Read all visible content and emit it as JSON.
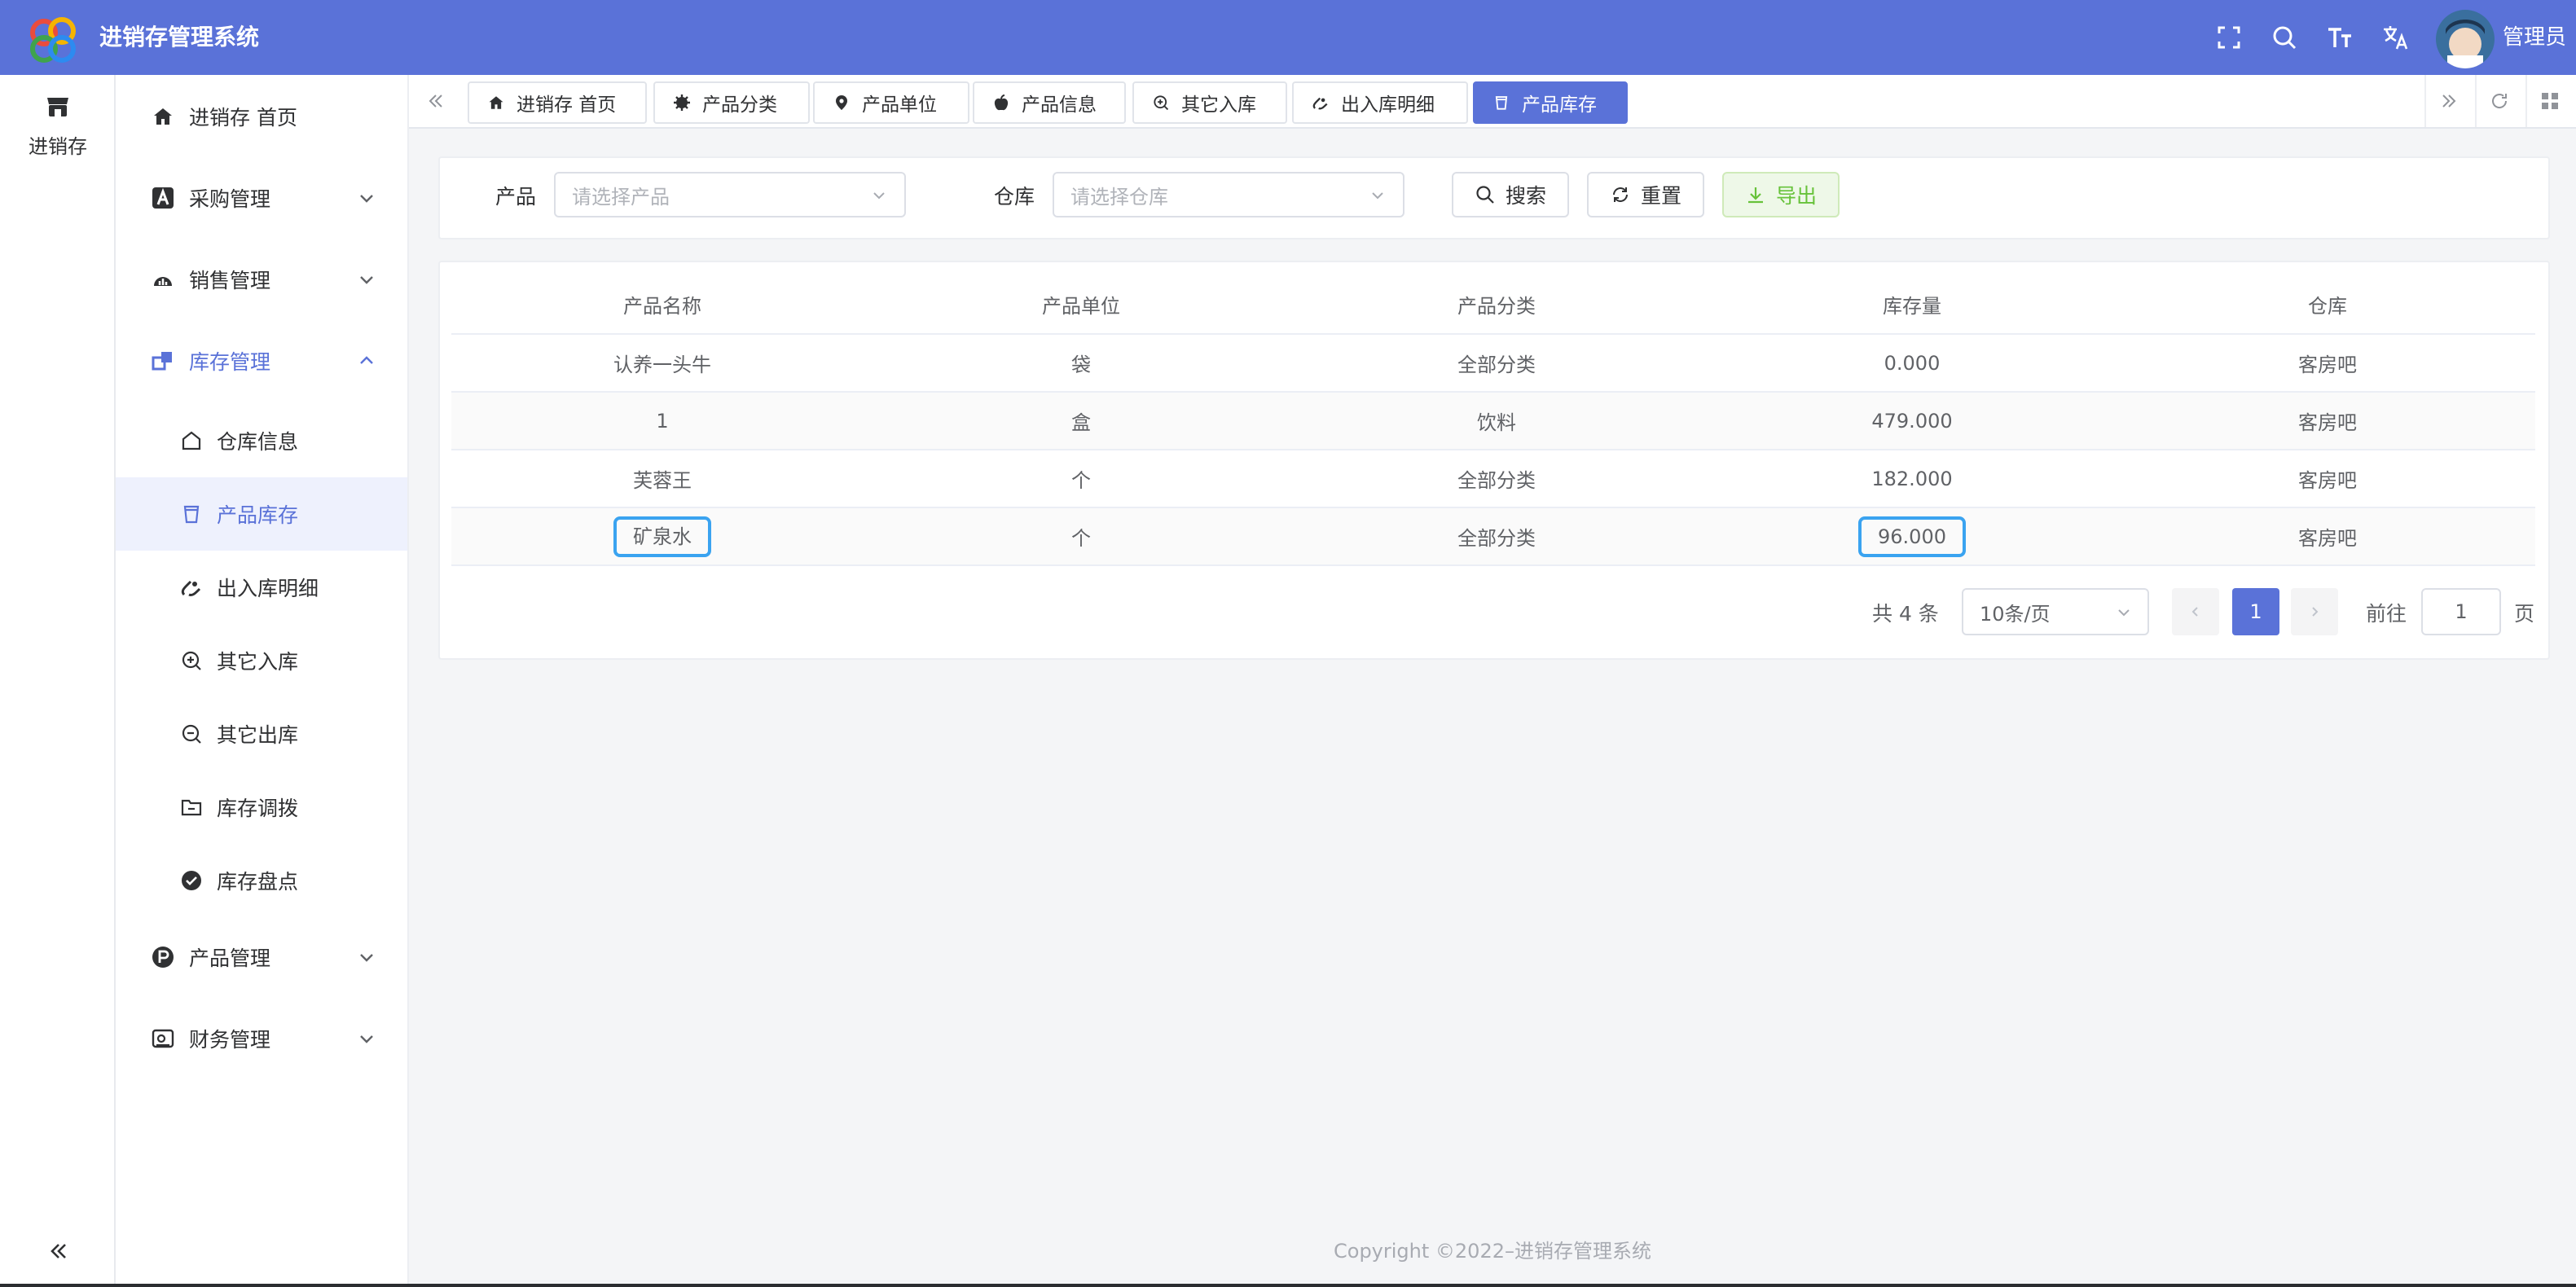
{
  "header": {
    "app_title": "进销存管理系统",
    "admin_name": "管理员",
    "icons": [
      "fullscreen-icon",
      "search-icon",
      "font-size-icon",
      "translate-icon"
    ],
    "brand_color": "#5a72d8"
  },
  "rail": {
    "label": "进销存",
    "icon": "store-icon"
  },
  "sidebar": {
    "home": "进销存 首页",
    "purchase": "采购管理",
    "sales": "销售管理",
    "inventory": "库存管理",
    "inventory_children": [
      "仓库信息",
      "产品库存",
      "出入库明细",
      "其它入库",
      "其它出库",
      "库存调拨",
      "库存盘点"
    ],
    "product": "产品管理",
    "finance": "财务管理"
  },
  "tabs": [
    "进销存 首页",
    "产品分类",
    "产品单位",
    "产品信息",
    "其它入库",
    "出入库明细",
    "产品库存"
  ],
  "filters": {
    "product_label": "产品",
    "product_placeholder": "请选择产品",
    "warehouse_label": "仓库",
    "warehouse_placeholder": "请选择仓库",
    "search_btn": "搜索",
    "reset_btn": "重置",
    "export_btn": "导出"
  },
  "table": {
    "columns": [
      "产品名称",
      "产品单位",
      "产品分类",
      "库存量",
      "仓库"
    ],
    "rows": [
      [
        "认养一头牛",
        "袋",
        "全部分类",
        "0.000",
        "客房吧"
      ],
      [
        "1",
        "盒",
        "饮料",
        "479.000",
        "客房吧"
      ],
      [
        "芙蓉王",
        "个",
        "全部分类",
        "182.000",
        "客房吧"
      ],
      [
        "矿泉水",
        "个",
        "全部分类",
        "96.000",
        "客房吧"
      ]
    ]
  },
  "pagination": {
    "total": "共 4 条",
    "page_size": "10条/页",
    "current": "1",
    "goto_label": "前往",
    "goto_value": "1",
    "page_suffix": "页"
  },
  "footer": "Copyright ©2022–进销存管理系统"
}
